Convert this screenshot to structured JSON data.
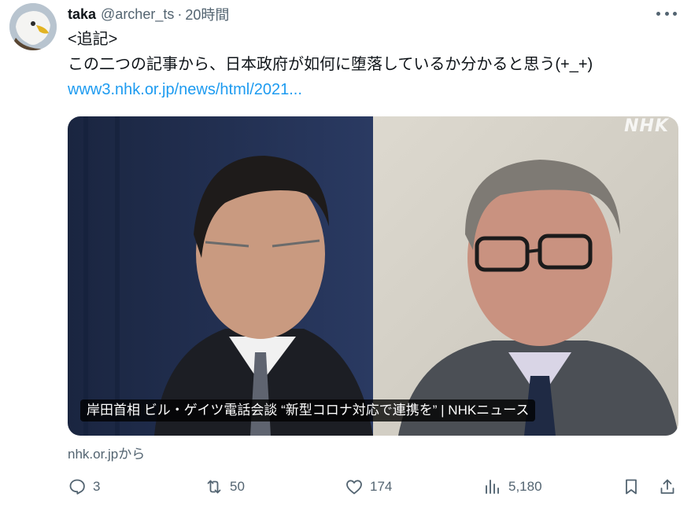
{
  "post": {
    "author": {
      "name": "taka",
      "handle": "@archer_ts",
      "separator": "·",
      "time": "20時間",
      "avatar_icon": "eagle-avatar"
    },
    "text": {
      "line1": "<追記>",
      "line2": "この二つの記事から、日本政府が如何に堕落しているか分かると思う(+_+)",
      "link": "www3.nhk.or.jp/news/html/2021..."
    },
    "card": {
      "title": "岸田首相 ビル・ゲイツ電話会談 “新型コロナ対応で連携を” | NHKニュース",
      "watermark": "NHK",
      "source": "nhk.or.jpから"
    },
    "actions": {
      "replies": "3",
      "retweets": "50",
      "likes": "174",
      "views": "5,180"
    }
  },
  "colors": {
    "text_primary": "#0f1419",
    "text_secondary": "#536471",
    "link": "#1d9bf0"
  }
}
